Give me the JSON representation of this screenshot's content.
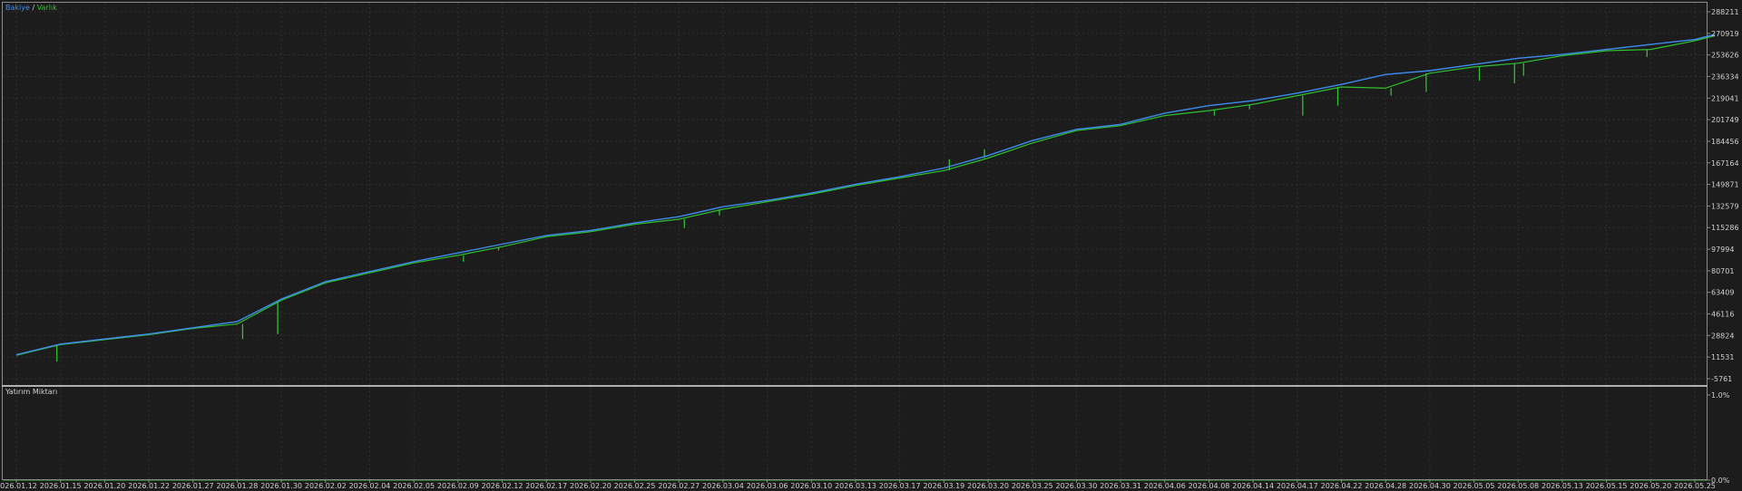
{
  "legend": {
    "balance": "Bakiye",
    "separator": "/",
    "equity": "Varlık"
  },
  "subpanel_label": "Yatırım Miktarı",
  "colors": {
    "background": "#1c1c1c",
    "grid": "#2f2f2f",
    "border": "#8a8a8a",
    "balance": "#3d8cf0",
    "equity": "#2fc12f",
    "text": "#cfcfcf"
  },
  "chart_data": [
    {
      "type": "line",
      "y_tick_labels": [
        "288211",
        "270919",
        "253626",
        "236334",
        "219041",
        "201749",
        "184456",
        "167164",
        "149871",
        "132579",
        "115286",
        "97994",
        "80701",
        "63409",
        "46116",
        "28824",
        "11531",
        "-5761"
      ],
      "ylim": [
        -5761,
        288211
      ],
      "x_tick_labels": [
        "2026.01.12",
        "2026.01.15",
        "2026.01.20",
        "2026.01.22",
        "2026.01.27",
        "2026.01.28",
        "2026.01.30",
        "2026.02.02",
        "2026.02.04",
        "2026.02.05",
        "2026.02.09",
        "2026.02.12",
        "2026.02.17",
        "2026.02.20",
        "2026.02.25",
        "2026.02.27",
        "2026.03.04",
        "2026.03.06",
        "2026.03.10",
        "2026.03.13",
        "2026.03.17",
        "2026.03.19",
        "2026.03.20",
        "2026.03.25",
        "2026.03.30",
        "2026.03.31",
        "2026.04.06",
        "2026.04.08",
        "2026.04.14",
        "2026.04.17",
        "2026.04.22",
        "2026.04.28",
        "2026.04.30",
        "2026.05.05",
        "2026.05.08",
        "2026.05.13",
        "2026.05.15",
        "2026.05.20",
        "2026.05.25"
      ],
      "series": [
        {
          "name": "Bakiye",
          "color": "#3d8cf0",
          "x": [
            "2026.01.12",
            "2026.01.15",
            "2026.01.20",
            "2026.01.22",
            "2026.01.27",
            "2026.01.28",
            "2026.01.30",
            "2026.02.02",
            "2026.02.04",
            "2026.02.05",
            "2026.02.09",
            "2026.02.12",
            "2026.02.17",
            "2026.02.20",
            "2026.02.25",
            "2026.02.27",
            "2026.03.04",
            "2026.03.06",
            "2026.03.10",
            "2026.03.13",
            "2026.03.17",
            "2026.03.19",
            "2026.03.20",
            "2026.03.25",
            "2026.03.30",
            "2026.03.31",
            "2026.04.06",
            "2026.04.08",
            "2026.04.14",
            "2026.04.17",
            "2026.04.22",
            "2026.04.28",
            "2026.04.30",
            "2026.05.05",
            "2026.05.08",
            "2026.05.13",
            "2026.05.15",
            "2026.05.20",
            "2026.05.25",
            "2026.05.27"
          ],
          "values": [
            13500,
            22000,
            26000,
            30000,
            35000,
            40000,
            58000,
            72000,
            80000,
            88000,
            95000,
            102000,
            109000,
            113000,
            119000,
            124000,
            132000,
            137000,
            143000,
            150000,
            156000,
            163000,
            173000,
            185000,
            194000,
            198000,
            207000,
            213000,
            217000,
            223000,
            230000,
            238000,
            241000,
            246000,
            251000,
            254000,
            258000,
            262000,
            266000,
            270000
          ]
        },
        {
          "name": "Varlık",
          "color": "#2fc12f",
          "x": [
            "2026.01.12",
            "2026.01.15",
            "2026.01.20",
            "2026.01.22",
            "2026.01.27",
            "2026.01.28",
            "2026.01.30",
            "2026.02.02",
            "2026.02.04",
            "2026.02.05",
            "2026.02.09",
            "2026.02.12",
            "2026.02.17",
            "2026.02.20",
            "2026.02.25",
            "2026.02.27",
            "2026.03.04",
            "2026.03.06",
            "2026.03.10",
            "2026.03.13",
            "2026.03.17",
            "2026.03.19",
            "2026.03.20",
            "2026.03.25",
            "2026.03.30",
            "2026.03.31",
            "2026.04.06",
            "2026.04.08",
            "2026.04.14",
            "2026.04.17",
            "2026.04.22",
            "2026.04.28",
            "2026.04.30",
            "2026.05.05",
            "2026.05.08",
            "2026.05.13",
            "2026.05.15",
            "2026.05.20",
            "2026.05.25",
            "2026.05.27"
          ],
          "values": [
            13000,
            21500,
            25500,
            29500,
            34500,
            38000,
            57000,
            71000,
            79000,
            87000,
            93000,
            100000,
            108000,
            112000,
            118000,
            122000,
            130000,
            136000,
            142000,
            149000,
            155000,
            161000,
            171000,
            183000,
            193000,
            197000,
            205000,
            209000,
            214000,
            221000,
            228000,
            227000,
            239000,
            244000,
            247000,
            253000,
            257000,
            258000,
            265000,
            269000
          ],
          "drawdowns": [
            {
              "x": "2026.01.15",
              "low": 8000
            },
            {
              "x": "2026.01.28",
              "low": 26000
            },
            {
              "x": "2026.01.30",
              "low": 30000
            },
            {
              "x": "2026.02.09",
              "low": 88000
            },
            {
              "x": "2026.02.12",
              "low": 97000
            },
            {
              "x": "2026.02.27",
              "low": 115000
            },
            {
              "x": "2026.03.04",
              "low": 125000
            },
            {
              "x": "2026.03.19",
              "low": 170000
            },
            {
              "x": "2026.03.20",
              "low": 178000
            },
            {
              "x": "2026.04.08",
              "low": 205000
            },
            {
              "x": "2026.04.14",
              "low": 210000
            },
            {
              "x": "2026.04.17",
              "low": 205000
            },
            {
              "x": "2026.04.22",
              "low": 213000
            },
            {
              "x": "2026.04.28",
              "low": 221000
            },
            {
              "x": "2026.04.30",
              "low": 224000
            },
            {
              "x": "2026.05.05",
              "low": 233000
            },
            {
              "x": "2026.05.08",
              "low": 231000
            },
            {
              "x": "2026.05.08",
              "low": 237000
            },
            {
              "x": "2026.05.20",
              "low": 252000
            }
          ]
        }
      ],
      "grid": true
    },
    {
      "type": "line",
      "title": "Yatırım Miktarı",
      "y_tick_labels": [
        "1.0%",
        "0.0%"
      ],
      "ylim": [
        0,
        1.0
      ],
      "series": [
        {
          "name": "Yatırım Miktarı",
          "color": "#2fc12f",
          "values": [
            0,
            0
          ]
        }
      ]
    }
  ]
}
